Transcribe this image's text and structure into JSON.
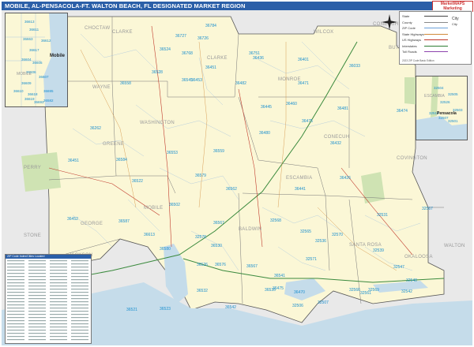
{
  "title": "MOBILE, AL-PENSACOLA-FT. WALTON BEACH, FL DESIGNATED MARKET REGION",
  "brand": {
    "line1": "MarketMAPS",
    "line2": "Marketing"
  },
  "legend": {
    "edition": "2023 ZIP Code Basic Edition",
    "items": [
      {
        "label": "State",
        "swatch": "#444444"
      },
      {
        "label": "County",
        "swatch": "#888888"
      },
      {
        "label": "ZIP Code",
        "swatch": "#6aa0d8"
      },
      {
        "label": "State Highways",
        "swatch": "#d08a3a"
      },
      {
        "label": "US Highways",
        "swatch": "#c0392b"
      },
      {
        "label": "Interstates",
        "swatch": "#2e7d32"
      },
      {
        "label": "Toll Roads",
        "swatch": "#8e44ad"
      }
    ],
    "city_symbol": "City",
    "city_symbol2": "City"
  },
  "counties": [
    {
      "name": "CHOCTAW"
    },
    {
      "name": "CLARKE"
    },
    {
      "name": "WILCOX"
    },
    {
      "name": "WAYNE"
    },
    {
      "name": "MONROE"
    },
    {
      "name": "WASHINGTON"
    },
    {
      "name": "CONECUH"
    },
    {
      "name": "GREENE"
    },
    {
      "name": "PERRY"
    },
    {
      "name": "ESCAMBIA"
    },
    {
      "name": "COVINGTON"
    },
    {
      "name": "MOBILE"
    },
    {
      "name": "BALDWIN"
    },
    {
      "name": "GEORGE"
    },
    {
      "name": "STONE"
    },
    {
      "name": "JACKSON"
    },
    {
      "name": "SANTA ROSA"
    },
    {
      "name": "OKALOOSA"
    },
    {
      "name": "WALTON"
    },
    {
      "name": "BUTLER"
    },
    {
      "name": "CONECUH"
    },
    {
      "name": "CLARKE"
    }
  ],
  "zips": [
    {
      "code": "36784"
    },
    {
      "code": "36727"
    },
    {
      "code": "36726"
    },
    {
      "code": "36768"
    },
    {
      "code": "36751"
    },
    {
      "code": "36524"
    },
    {
      "code": "36436"
    },
    {
      "code": "36451"
    },
    {
      "code": "36453"
    },
    {
      "code": "36401"
    },
    {
      "code": "36033"
    },
    {
      "code": "36558"
    },
    {
      "code": "36528"
    },
    {
      "code": "36545"
    },
    {
      "code": "36482"
    },
    {
      "code": "36471"
    },
    {
      "code": "36445"
    },
    {
      "code": "36460"
    },
    {
      "code": "36475"
    },
    {
      "code": "36481"
    },
    {
      "code": "36432"
    },
    {
      "code": "36474"
    },
    {
      "code": "36262"
    },
    {
      "code": "36451"
    },
    {
      "code": "36584"
    },
    {
      "code": "36553"
    },
    {
      "code": "36480"
    },
    {
      "code": "36559"
    },
    {
      "code": "36579"
    },
    {
      "code": "36426"
    },
    {
      "code": "36522"
    },
    {
      "code": "36562"
    },
    {
      "code": "36441"
    },
    {
      "code": "36452"
    },
    {
      "code": "36587"
    },
    {
      "code": "36502"
    },
    {
      "code": "36567"
    },
    {
      "code": "32565"
    },
    {
      "code": "32531"
    },
    {
      "code": "32567"
    },
    {
      "code": "36613"
    },
    {
      "code": "36580"
    },
    {
      "code": "36576"
    },
    {
      "code": "32568"
    },
    {
      "code": "32570"
    },
    {
      "code": "32536"
    },
    {
      "code": "32539"
    },
    {
      "code": "32571"
    },
    {
      "code": "36526"
    },
    {
      "code": "36567"
    },
    {
      "code": "32547"
    },
    {
      "code": "36541"
    },
    {
      "code": "36532"
    },
    {
      "code": "36535"
    },
    {
      "code": "36523"
    },
    {
      "code": "32569"
    },
    {
      "code": "32566"
    },
    {
      "code": "32506"
    },
    {
      "code": "32578"
    },
    {
      "code": "36530"
    },
    {
      "code": "36542"
    },
    {
      "code": "32507"
    },
    {
      "code": "32561"
    },
    {
      "code": "32548"
    },
    {
      "code": "36475"
    },
    {
      "code": "36470"
    },
    {
      "code": "36521"
    },
    {
      "code": "32542"
    }
  ],
  "inset_mobile": {
    "city": "Mobile",
    "zips": [
      "36613",
      "36611",
      "36663",
      "36612",
      "36617",
      "36604",
      "36605",
      "36606",
      "36607",
      "36609",
      "36610",
      "36618",
      "36619",
      "36693",
      "36695",
      "36582"
    ],
    "label": "MOBILE"
  },
  "inset_pensacola": {
    "city": "Pensacola",
    "zips": [
      "32504",
      "32505",
      "32526",
      "32503",
      "32514",
      "32507",
      "32501"
    ],
    "label": "ESCAMBIA"
  },
  "zip_index": {
    "header": "ZIP Code Index/Cities Located"
  }
}
